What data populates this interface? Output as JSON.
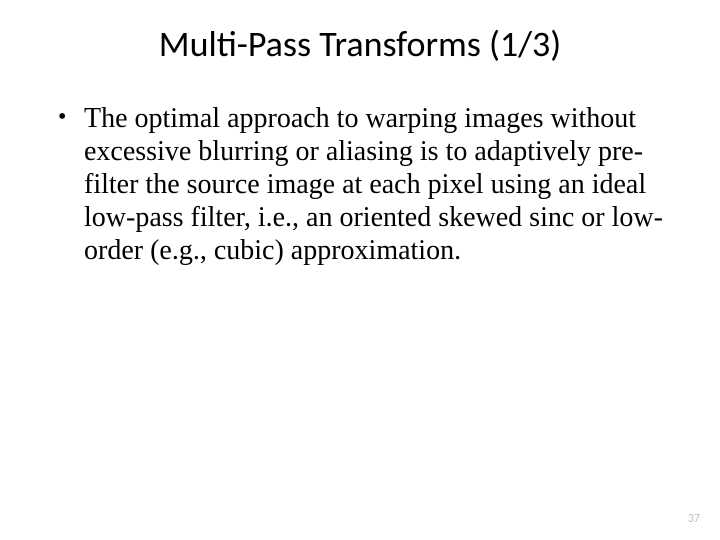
{
  "slide": {
    "title": "Multi-Pass Transforms (1/3)",
    "bullets": [
      "The optimal approach to warping images without excessive blurring or aliasing is to adaptively pre-filter the source image at each pixel using an ideal low-pass filter, i.e., an oriented skewed sinc or low-order (e.g., cubic) approximation."
    ],
    "page_number": "37"
  }
}
